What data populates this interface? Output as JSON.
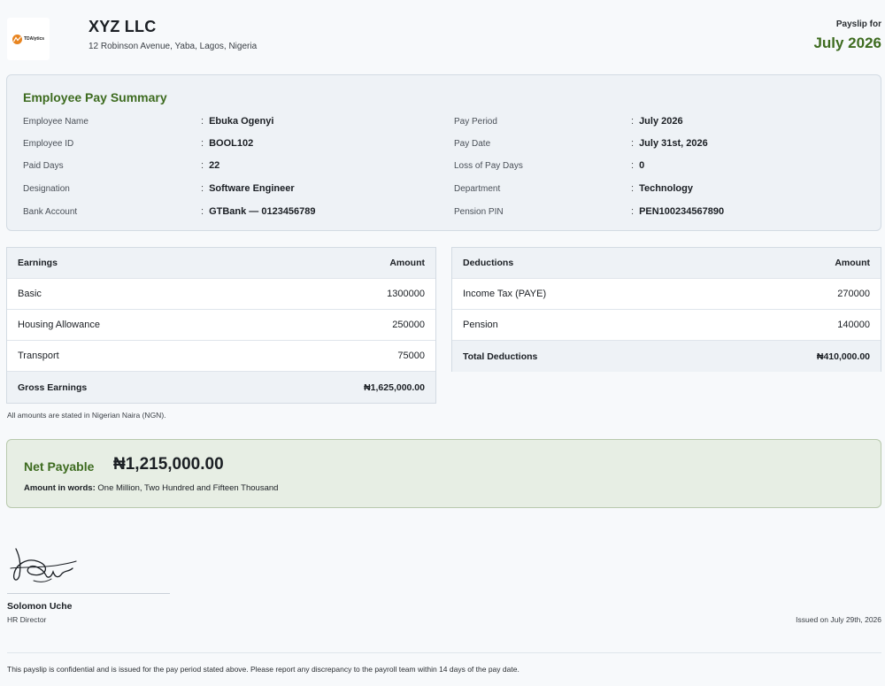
{
  "header": {
    "logo_text": "TDAlytics",
    "company_name": "XYZ LLC",
    "company_address": "12 Robinson Avenue, Yaba, Lagos, Nigeria",
    "payslip_for_label": "Payslip for",
    "payslip_month": "July 2026"
  },
  "summary": {
    "title": "Employee Pay Summary",
    "left": [
      {
        "label": "Employee Name",
        "value": "Ebuka Ogenyi"
      },
      {
        "label": "Employee ID",
        "value": "BOOL102"
      },
      {
        "label": "Paid Days",
        "value": "22"
      },
      {
        "label": "Designation",
        "value": "Software Engineer"
      },
      {
        "label": "Bank Account",
        "value": "GTBank — 0123456789"
      }
    ],
    "right": [
      {
        "label": "Pay Period",
        "value": "July 2026"
      },
      {
        "label": "Pay Date",
        "value": "July 31st, 2026"
      },
      {
        "label": "Loss of Pay Days",
        "value": "0"
      },
      {
        "label": "Department",
        "value": "Technology"
      },
      {
        "label": "Pension PIN",
        "value": "PEN100234567890"
      }
    ]
  },
  "earnings": {
    "header_label": "Earnings",
    "header_amount": "Amount",
    "rows": [
      {
        "label": "Basic",
        "amount": "1300000"
      },
      {
        "label": "Housing Allowance",
        "amount": "250000"
      },
      {
        "label": "Transport",
        "amount": "75000"
      }
    ],
    "total_label": "Gross Earnings",
    "total_amount": "₦1,625,000.00"
  },
  "deductions": {
    "header_label": "Deductions",
    "header_amount": "Amount",
    "rows": [
      {
        "label": "Income Tax (PAYE)",
        "amount": "270000"
      },
      {
        "label": "Pension",
        "amount": "140000"
      }
    ],
    "total_label": "Total Deductions",
    "total_amount": "₦410,000.00"
  },
  "currency_note": "All amounts are stated in Nigerian Naira (NGN).",
  "net": {
    "label": "Net Payable",
    "amount": "₦1,215,000.00",
    "words_label": "Amount in words:",
    "words_value": "One Million, Two Hundred and Fifteen Thousand"
  },
  "signatory": {
    "name": "Solomon Uche",
    "role": "HR Director"
  },
  "issued_on": "Issued on July 29th, 2026",
  "footer_note": "This payslip is confidential and is issued for the pay period stated above. Please report any discrepancy to the payroll team within 14 days of the pay date.",
  "icons": {
    "logo": "company-logo-icon",
    "signature": "signature-icon"
  },
  "colors": {
    "accent_green": "#3d6b1f",
    "logo_orange": "#e8841f",
    "card_bg": "#eef2f6",
    "net_bg": "#e7eee4"
  }
}
